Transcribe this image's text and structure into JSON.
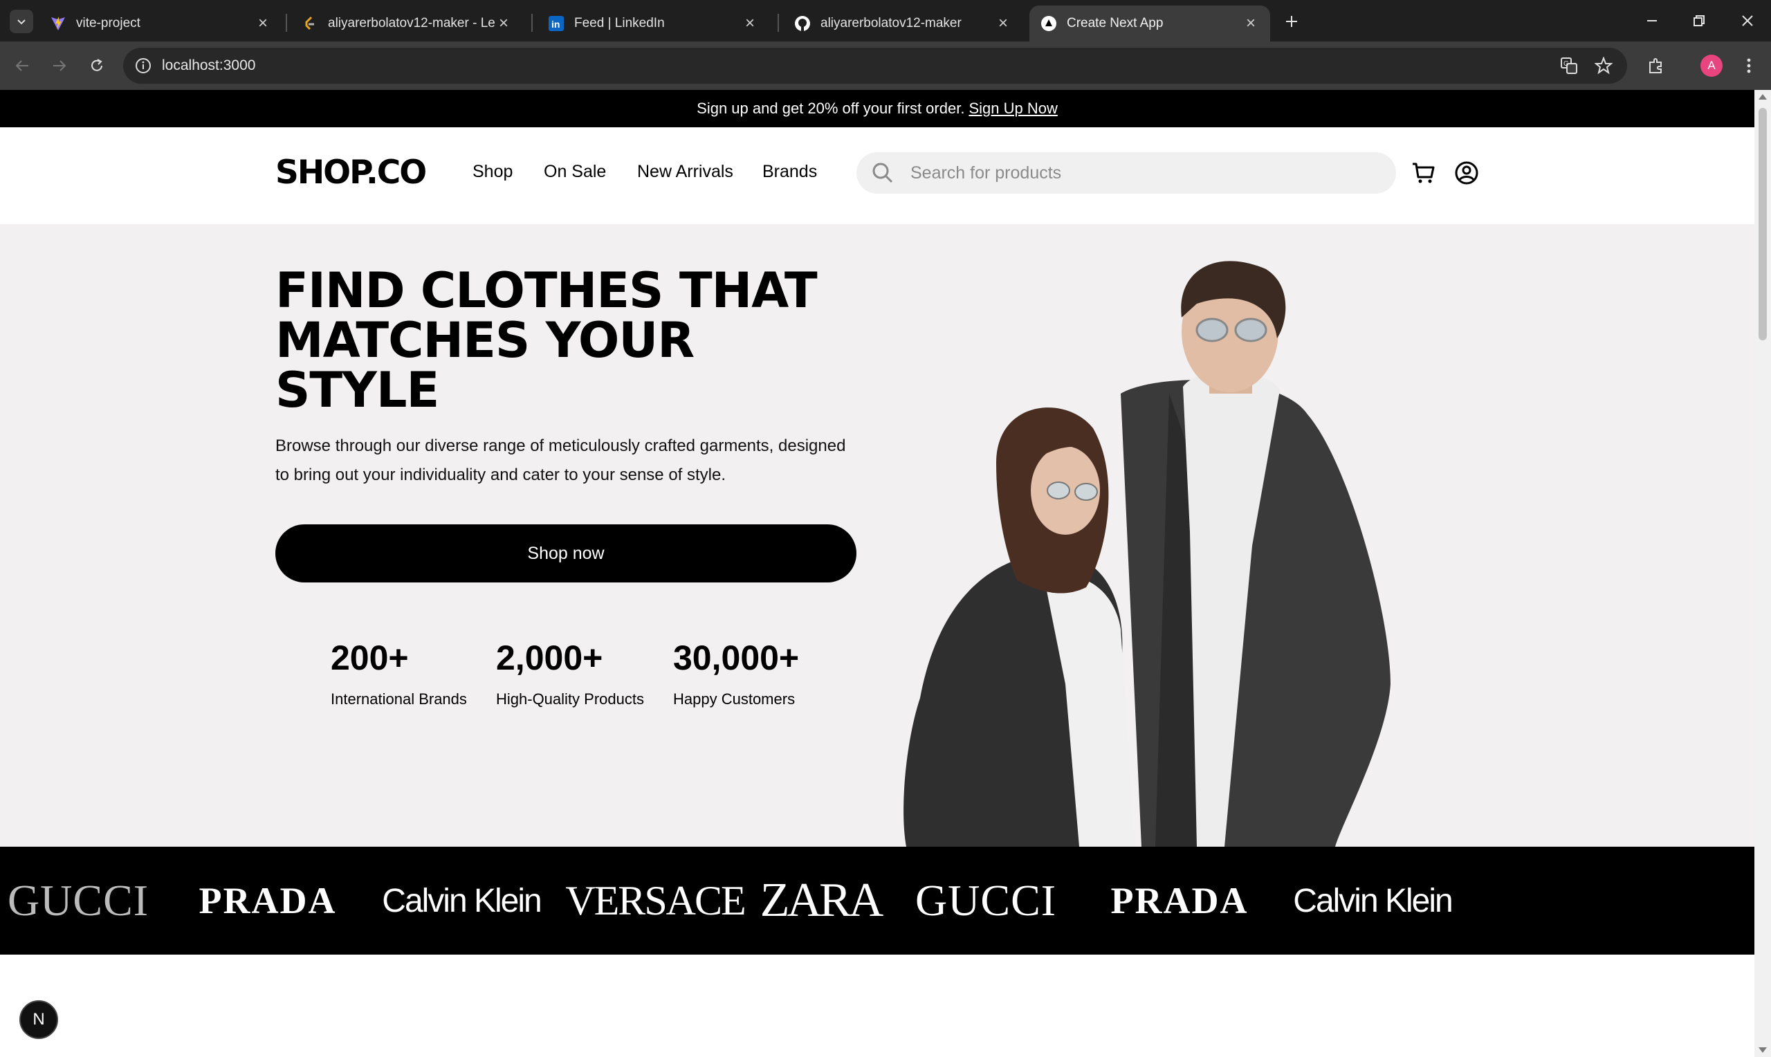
{
  "browser": {
    "tabs": [
      {
        "title": "vite-project",
        "icon": "vite-icon",
        "active": false
      },
      {
        "title": "aliyarerbolatov12-maker - LeetC",
        "icon": "leetcode-icon",
        "active": false
      },
      {
        "title": "Feed | LinkedIn",
        "icon": "linkedin-icon",
        "active": false
      },
      {
        "title": "aliyarerbolatov12-maker",
        "icon": "github-icon",
        "active": false
      },
      {
        "title": "Create Next App",
        "icon": "nextjs-icon",
        "active": true
      }
    ],
    "url": "localhost:3000",
    "profile_initial": "A"
  },
  "promo": {
    "text": "Sign up and get 20% off your first order.",
    "link": "Sign Up Now"
  },
  "header": {
    "logo": "SHOP.CO",
    "nav": [
      "Shop",
      "On Sale",
      "New Arrivals",
      "Brands"
    ],
    "search_placeholder": "Search for products"
  },
  "hero": {
    "title_lines": [
      "FIND CLOTHES THAT",
      "MATCHES YOUR",
      "STYLE"
    ],
    "description_line1": "Browse through our diverse range of meticulously crafted garments, designed",
    "description_line2": "to bring out your individuality and cater to your sense of style.",
    "cta": "Shop now",
    "stats": [
      {
        "value": "200+",
        "label": "International Brands"
      },
      {
        "value": "2,000+",
        "label": "High-Quality Products"
      },
      {
        "value": "30,000+",
        "label": "Happy Customers"
      }
    ]
  },
  "brands": [
    "GUCCI",
    "PRADA",
    "Calvin Klein",
    "VERSACE",
    "ZARA",
    "GUCCI",
    "PRADA",
    "Calvin Klein"
  ],
  "dev_badge": "N",
  "colors": {
    "promo_bg": "#000000",
    "hero_bg": "#F2F0F1",
    "search_bg": "#F0F0F0",
    "button_bg": "#000000",
    "browser_bg": "#1F1F1F",
    "profile": "#E8457E"
  }
}
